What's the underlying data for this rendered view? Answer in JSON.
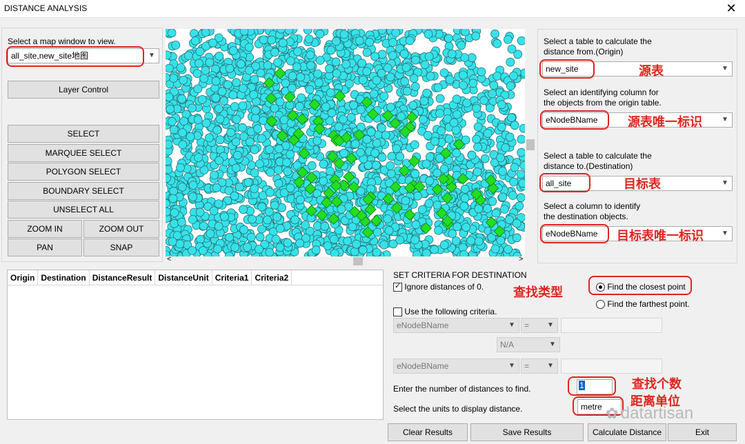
{
  "window": {
    "title": "DISTANCE ANALYSIS",
    "close_glyph": "✕"
  },
  "left": {
    "select_map_label": "Select a map window to view.",
    "map_window_value": "all_site,new_site地图",
    "layer_control": "Layer Control",
    "select": "SELECT",
    "marquee_select": "MARQUEE SELECT",
    "polygon_select": "POLYGON SELECT",
    "boundary_select": "BOUNDARY SELECT",
    "unselect_all": "UNSELECT ALL",
    "zoom_in": "ZOOM IN",
    "zoom_out": "ZOOM OUT",
    "pan": "PAN",
    "snap": "SNAP"
  },
  "map": {
    "point_color": "#36e2ea",
    "site_color": "#22dd22",
    "scroll_left": "<",
    "scroll_right": ">"
  },
  "right": {
    "origin_table_label_1": "Select a table to calculate the",
    "origin_table_label_2": "distance from.(Origin)",
    "origin_table_value": "new_site",
    "origin_table_ann": "源表",
    "origin_col_label_1": "Select an identifying column for",
    "origin_col_label_2": "the objects from the origin table.",
    "origin_col_value": "eNodeBName",
    "origin_col_ann": "源表唯一标识",
    "dest_table_label_1": "Select a table to calculate the",
    "dest_table_label_2": "distance to.(Destination)",
    "dest_table_value": "all_site",
    "dest_table_ann": "目标表",
    "dest_col_label_1": "Select a column to identify",
    "dest_col_label_2": "the destination objects.",
    "dest_col_value": "eNodeBName",
    "dest_col_ann": "目标表唯一标识"
  },
  "results": {
    "columns": [
      "Origin",
      "Destination",
      "DistanceResult",
      "DistanceUnit",
      "Criteria1",
      "Criteria2"
    ]
  },
  "criteria": {
    "title": "SET CRITERIA FOR DESTINATION",
    "ignore_zero": "Ignore distances of 0.",
    "find_type_ann": "查找类型",
    "closest": "Find the closest point",
    "farthest": "Find the farthest point.",
    "use_criteria": "Use the following criteria.",
    "crit1_field": "eNodeBName",
    "crit1_op": "=",
    "joiner": "N/A",
    "crit2_field": "eNodeBName",
    "crit2_op": "=",
    "num_label": "Enter the number of distances to find.",
    "num_value": "1",
    "num_ann": "查找个数",
    "units_label": "Select the units to display distance.",
    "units_value": "metre",
    "units_ann": "距离单位"
  },
  "footer": {
    "clear": "Clear Results",
    "save": "Save Results",
    "calculate": "Calculate Distance",
    "exit": "Exit"
  },
  "watermark": {
    "text": "datartisan"
  }
}
